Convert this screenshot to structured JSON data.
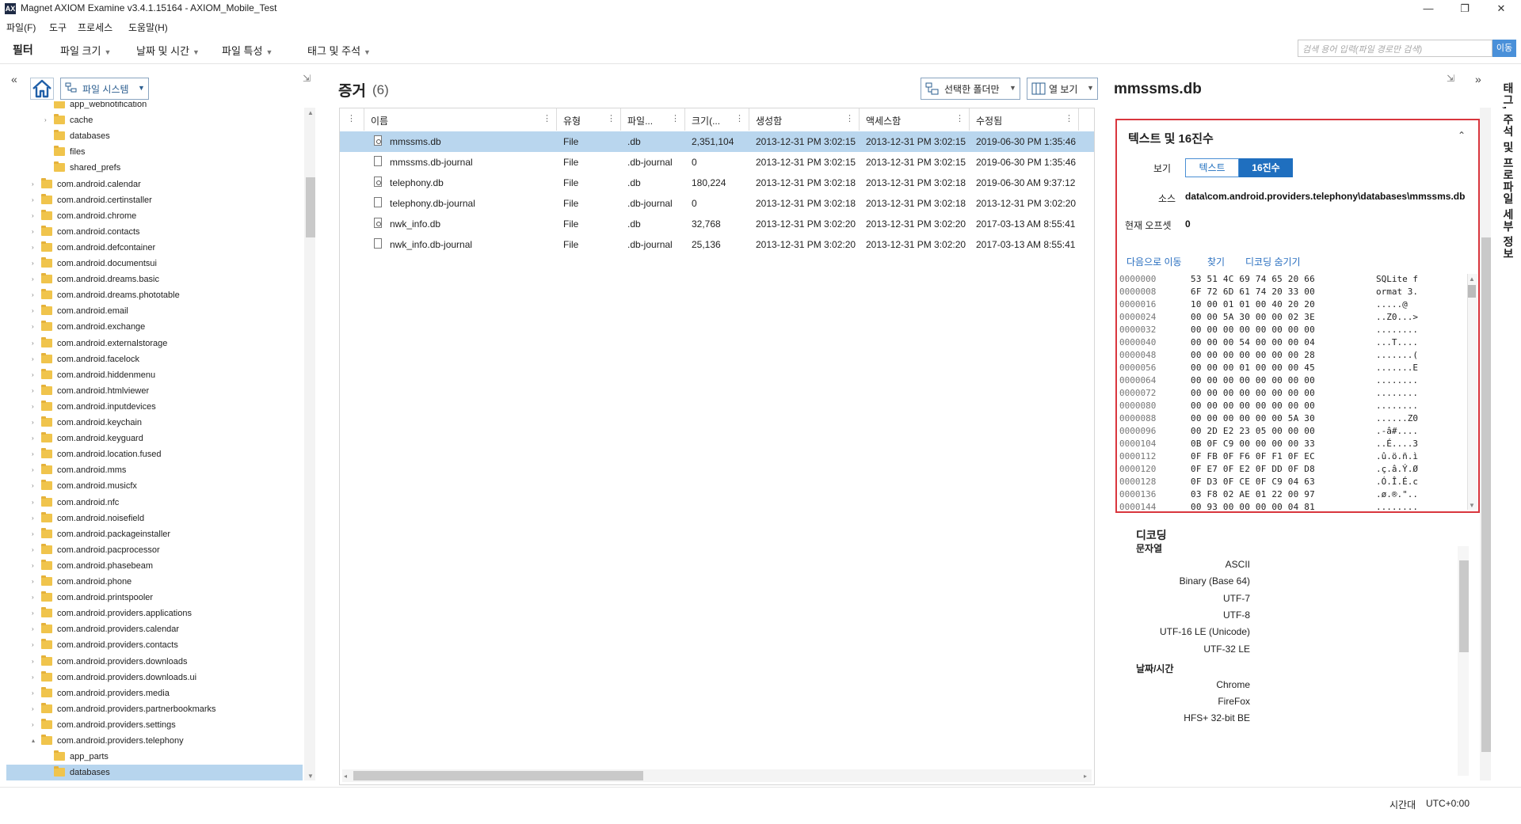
{
  "window": {
    "title": "Magnet AXIOM Examine v3.4.1.15164 - AXIOM_Mobile_Test",
    "app_icon": "AX",
    "controls": [
      "—",
      "❐",
      "✕"
    ]
  },
  "menu": [
    "파일(F)",
    "도구",
    "프로세스",
    "도움말(H)"
  ],
  "filterbar": {
    "title": "필터",
    "filters": [
      "파일 크기",
      "날짜 및 시간",
      "파일 특성",
      "태그 및 주석"
    ],
    "search_placeholder": "검색 용어 입력(파일 경로만 검색)",
    "search_button": "이동"
  },
  "left": {
    "collapse": "«",
    "pin": "⇲",
    "dropdown_label": "파일 시스템",
    "tree": [
      {
        "label": "app_webnotification",
        "level": 2,
        "exp": ""
      },
      {
        "label": "cache",
        "level": 2,
        "exp": "›"
      },
      {
        "label": "databases",
        "level": 2,
        "exp": ""
      },
      {
        "label": "files",
        "level": 2,
        "exp": ""
      },
      {
        "label": "shared_prefs",
        "level": 2,
        "exp": ""
      },
      {
        "label": "com.android.calendar",
        "level": 1,
        "exp": "›"
      },
      {
        "label": "com.android.certinstaller",
        "level": 1,
        "exp": "›"
      },
      {
        "label": "com.android.chrome",
        "level": 1,
        "exp": "›"
      },
      {
        "label": "com.android.contacts",
        "level": 1,
        "exp": "›"
      },
      {
        "label": "com.android.defcontainer",
        "level": 1,
        "exp": "›"
      },
      {
        "label": "com.android.documentsui",
        "level": 1,
        "exp": "›"
      },
      {
        "label": "com.android.dreams.basic",
        "level": 1,
        "exp": "›"
      },
      {
        "label": "com.android.dreams.phototable",
        "level": 1,
        "exp": "›"
      },
      {
        "label": "com.android.email",
        "level": 1,
        "exp": "›"
      },
      {
        "label": "com.android.exchange",
        "level": 1,
        "exp": "›"
      },
      {
        "label": "com.android.externalstorage",
        "level": 1,
        "exp": "›"
      },
      {
        "label": "com.android.facelock",
        "level": 1,
        "exp": "›"
      },
      {
        "label": "com.android.hiddenmenu",
        "level": 1,
        "exp": "›"
      },
      {
        "label": "com.android.htmlviewer",
        "level": 1,
        "exp": "›"
      },
      {
        "label": "com.android.inputdevices",
        "level": 1,
        "exp": "›"
      },
      {
        "label": "com.android.keychain",
        "level": 1,
        "exp": "›"
      },
      {
        "label": "com.android.keyguard",
        "level": 1,
        "exp": "›"
      },
      {
        "label": "com.android.location.fused",
        "level": 1,
        "exp": "›"
      },
      {
        "label": "com.android.mms",
        "level": 1,
        "exp": "›"
      },
      {
        "label": "com.android.musicfx",
        "level": 1,
        "exp": "›"
      },
      {
        "label": "com.android.nfc",
        "level": 1,
        "exp": "›"
      },
      {
        "label": "com.android.noisefield",
        "level": 1,
        "exp": "›"
      },
      {
        "label": "com.android.packageinstaller",
        "level": 1,
        "exp": "›"
      },
      {
        "label": "com.android.pacprocessor",
        "level": 1,
        "exp": "›"
      },
      {
        "label": "com.android.phasebeam",
        "level": 1,
        "exp": "›"
      },
      {
        "label": "com.android.phone",
        "level": 1,
        "exp": "›"
      },
      {
        "label": "com.android.printspooler",
        "level": 1,
        "exp": "›"
      },
      {
        "label": "com.android.providers.applications",
        "level": 1,
        "exp": "›"
      },
      {
        "label": "com.android.providers.calendar",
        "level": 1,
        "exp": "›"
      },
      {
        "label": "com.android.providers.contacts",
        "level": 1,
        "exp": "›"
      },
      {
        "label": "com.android.providers.downloads",
        "level": 1,
        "exp": "›"
      },
      {
        "label": "com.android.providers.downloads.ui",
        "level": 1,
        "exp": "›"
      },
      {
        "label": "com.android.providers.media",
        "level": 1,
        "exp": "›"
      },
      {
        "label": "com.android.providers.partnerbookmarks",
        "level": 1,
        "exp": "›"
      },
      {
        "label": "com.android.providers.settings",
        "level": 1,
        "exp": "›"
      },
      {
        "label": "com.android.providers.telephony",
        "level": 1,
        "exp": "▴"
      },
      {
        "label": "app_parts",
        "level": 2,
        "exp": ""
      },
      {
        "label": "databases",
        "level": 2,
        "exp": "",
        "selected": true
      }
    ]
  },
  "center": {
    "title": "증거",
    "count": "(6)",
    "folder_only": "선택한 폴더만",
    "col_view": "열 보기",
    "columns": [
      "이름",
      "유형",
      "파일...",
      "크기(...",
      "생성함",
      "액세스함",
      "수정됨"
    ],
    "rows": [
      {
        "name": "mmssms.db",
        "type": "File",
        "ext": ".db",
        "size": "2,351,104",
        "created": "2013-12-31 PM 3:02:15",
        "accessed": "2013-12-31 PM 3:02:15",
        "modified": "2019-06-30 PM 1:35:46",
        "db": true,
        "selected": true
      },
      {
        "name": "mmssms.db-journal",
        "type": "File",
        "ext": ".db-journal",
        "size": "0",
        "created": "2013-12-31 PM 3:02:15",
        "accessed": "2013-12-31 PM 3:02:15",
        "modified": "2019-06-30 PM 1:35:46",
        "db": false
      },
      {
        "name": "telephony.db",
        "type": "File",
        "ext": ".db",
        "size": "180,224",
        "created": "2013-12-31 PM 3:02:18",
        "accessed": "2013-12-31 PM 3:02:18",
        "modified": "2019-06-30 AM 9:37:12",
        "db": true
      },
      {
        "name": "telephony.db-journal",
        "type": "File",
        "ext": ".db-journal",
        "size": "0",
        "created": "2013-12-31 PM 3:02:18",
        "accessed": "2013-12-31 PM 3:02:18",
        "modified": "2013-12-31 PM 3:02:20",
        "db": false
      },
      {
        "name": "nwk_info.db",
        "type": "File",
        "ext": ".db",
        "size": "32,768",
        "created": "2013-12-31 PM 3:02:20",
        "accessed": "2013-12-31 PM 3:02:20",
        "modified": "2017-03-13 AM 8:55:41",
        "db": true
      },
      {
        "name": "nwk_info.db-journal",
        "type": "File",
        "ext": ".db-journal",
        "size": "25,136",
        "created": "2013-12-31 PM 3:02:20",
        "accessed": "2013-12-31 PM 3:02:20",
        "modified": "2017-03-13 AM 8:55:41",
        "db": false
      }
    ]
  },
  "right": {
    "title": "mmssms.db",
    "pin": "⇲",
    "expand": "»",
    "side_tab": "태그, 주석 및 프로파일 세부 정보",
    "card": {
      "title": "텍스트 및 16진수",
      "collapse": "⌃",
      "view_label": "보기",
      "toggle_text": "텍스트",
      "toggle_hex": "16진수",
      "source_label": "소스",
      "source_value": "data\\com.android.providers.telephony\\databases\\mmssms.db",
      "offset_label": "현재 오프셋",
      "offset_value": "0",
      "links": [
        "다음으로 이동",
        "찾기",
        "디코딩 숨기기"
      ],
      "hex_rows": [
        {
          "off": "0000000",
          "bytes": "53 51 4C 69 74 65 20 66",
          "ascii": "SQLite f"
        },
        {
          "off": "0000008",
          "bytes": "6F 72 6D 61 74 20 33 00",
          "ascii": "ormat 3."
        },
        {
          "off": "0000016",
          "bytes": "10 00 01 01 00 40 20 20",
          "ascii": ".....@"
        },
        {
          "off": "0000024",
          "bytes": "00 00 5A 30 00 00 02 3E",
          "ascii": "..Z0...>"
        },
        {
          "off": "0000032",
          "bytes": "00 00 00 00 00 00 00 00",
          "ascii": "........"
        },
        {
          "off": "0000040",
          "bytes": "00 00 00 54 00 00 00 04",
          "ascii": "...T...."
        },
        {
          "off": "0000048",
          "bytes": "00 00 00 00 00 00 00 28",
          "ascii": ".......("
        },
        {
          "off": "0000056",
          "bytes": "00 00 00 01 00 00 00 45",
          "ascii": ".......E"
        },
        {
          "off": "0000064",
          "bytes": "00 00 00 00 00 00 00 00",
          "ascii": "........"
        },
        {
          "off": "0000072",
          "bytes": "00 00 00 00 00 00 00 00",
          "ascii": "........"
        },
        {
          "off": "0000080",
          "bytes": "00 00 00 00 00 00 00 00",
          "ascii": "........"
        },
        {
          "off": "0000088",
          "bytes": "00 00 00 00 00 00 5A 30",
          "ascii": "......Z0"
        },
        {
          "off": "0000096",
          "bytes": "00 2D E2 23 05 00 00 00",
          "ascii": ".-â#...."
        },
        {
          "off": "0000104",
          "bytes": "0B 0F C9 00 00 00 00 33",
          "ascii": "..É....3"
        },
        {
          "off": "0000112",
          "bytes": "0F FB 0F F6 0F F1 0F EC",
          "ascii": ".û.ö.ñ.ì"
        },
        {
          "off": "0000120",
          "bytes": "0F E7 0F E2 0F DD 0F D8",
          "ascii": ".ç.â.Ý.Ø"
        },
        {
          "off": "0000128",
          "bytes": "0F D3 0F CE 0F C9 04 63",
          "ascii": ".Ó.Î.É.c"
        },
        {
          "off": "0000136",
          "bytes": "03 F8 02 AE 01 22 00 97",
          "ascii": ".ø.®.\".."
        },
        {
          "off": "0000144",
          "bytes": "00 93 00 00 00 00 04 81",
          "ascii": "........"
        }
      ]
    },
    "decode": {
      "title": "디코딩",
      "sections": [
        {
          "head": "문자열",
          "items": [
            "ASCII",
            "Binary (Base 64)",
            "UTF-7",
            "UTF-8",
            "UTF-16 LE (Unicode)",
            "UTF-32 LE"
          ]
        },
        {
          "head": "날짜/시간",
          "items": [
            "Chrome",
            "FireFox",
            "HFS+ 32-bit BE"
          ]
        }
      ]
    }
  },
  "status": {
    "tz_label": "시간대",
    "tz_value": "UTC+0:00"
  },
  "colors": {
    "accent": "#1f6fbf",
    "selection": "#b9d6ee",
    "highlight_border": "#d9363e",
    "folder": "#f0c44c"
  }
}
